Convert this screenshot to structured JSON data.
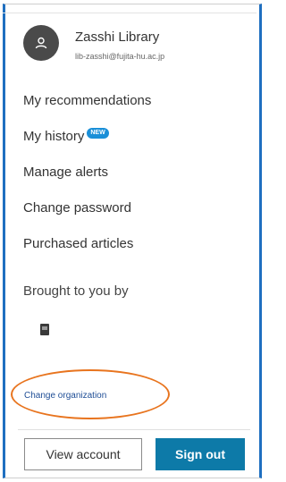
{
  "user": {
    "name": "Zasshi Library",
    "email": "lib-zasshi@fujita-hu.ac.jp",
    "avatar_icon": "user-icon"
  },
  "menu": {
    "items": [
      {
        "label": "My recommendations"
      },
      {
        "label": "My history",
        "badge": "NEW"
      },
      {
        "label": "Manage alerts"
      },
      {
        "label": "Change password"
      },
      {
        "label": "Purchased articles"
      }
    ]
  },
  "institution": {
    "brought_label": "Brought to you by",
    "logo_icon": "organization-logo-icon",
    "change_link": "Change organization"
  },
  "actions": {
    "view_account": "View account",
    "sign_out": "Sign out"
  },
  "colors": {
    "accent_border": "#1f6fc0",
    "sign_out_bg": "#0d7aa8",
    "link": "#1f4e96",
    "badge": "#1a8fd8",
    "highlight": "#e8741e"
  }
}
